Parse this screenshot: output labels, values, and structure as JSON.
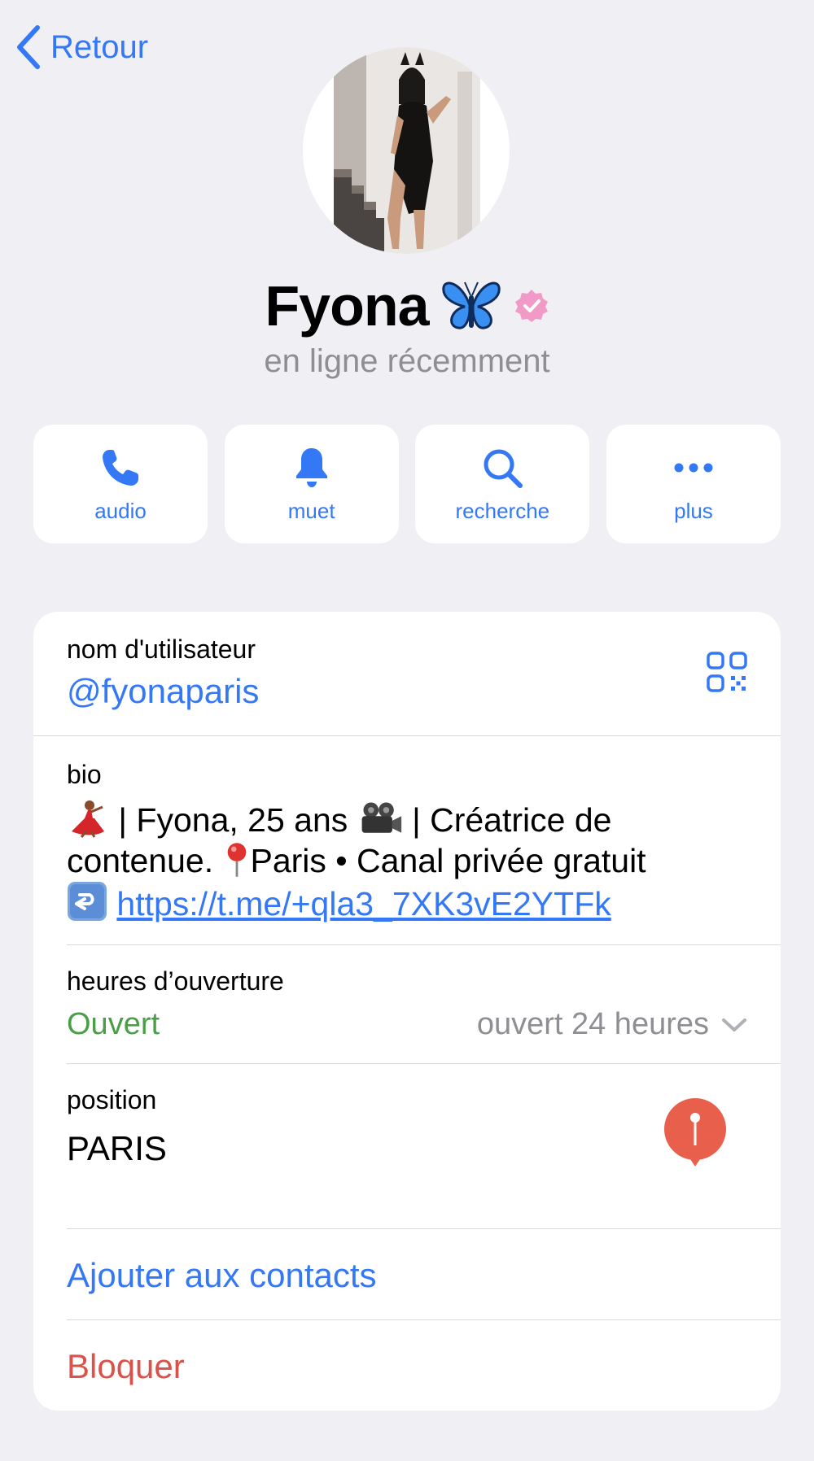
{
  "nav": {
    "back_label": "Retour"
  },
  "profile": {
    "name": "Fyona",
    "name_emoji": "butterfly-emoji",
    "verified_badge": "verified-badge-icon",
    "status": "en ligne récemment"
  },
  "actions": [
    {
      "label": "audio",
      "icon": "phone-icon"
    },
    {
      "label": "muet",
      "icon": "bell-icon"
    },
    {
      "label": "recherche",
      "icon": "search-icon"
    },
    {
      "label": "plus",
      "icon": "more-dots-icon"
    }
  ],
  "info": {
    "username": {
      "label": "nom d'utilisateur",
      "value": "@fyonaparis",
      "icon": "qr-code-icon"
    },
    "bio": {
      "label": "bio",
      "part1": " | Fyona, 25 ans ",
      "part2": " | Créatrice de contenue. ",
      "part3": "Paris • Canal privée gratuit ",
      "link": "https://t.me/+qla3_7XK3vE2YTFk"
    },
    "hours": {
      "label": "heures d’ouverture",
      "status": "Ouvert",
      "detail": "ouvert 24 heures"
    },
    "position": {
      "label": "position",
      "value": "PARIS",
      "icon": "map-pin-icon"
    },
    "add_contact": "Ajouter aux contacts",
    "block": "Bloquer"
  },
  "colors": {
    "accent": "#3478f6",
    "open_green": "#4a9e47",
    "danger_red": "#d9534a",
    "verified_pink": "#f19ac8",
    "pin_red": "#e8604c",
    "background": "#efeff4"
  }
}
